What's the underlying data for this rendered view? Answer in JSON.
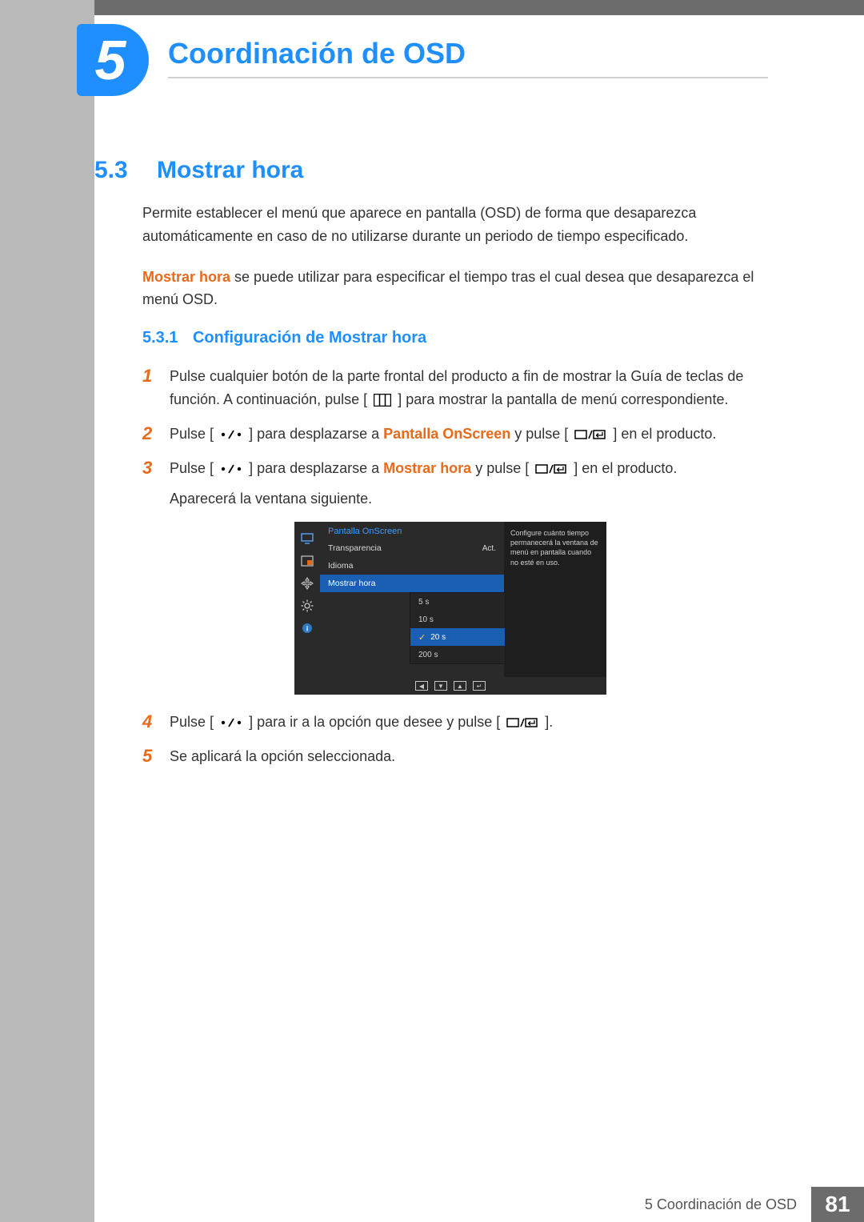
{
  "chapter": {
    "number": "5",
    "title": "Coordinación de OSD"
  },
  "section": {
    "number": "5.3",
    "title": "Mostrar hora"
  },
  "intro": {
    "p1": "Permite establecer el menú que aparece en pantalla (OSD) de forma que desaparezca automáticamente en caso de no utilizarse durante un periodo de tiempo especificado.",
    "p2_strong": "Mostrar hora",
    "p2_rest": " se puede utilizar para especificar el tiempo tras el cual desea que desaparezca el menú OSD."
  },
  "subsection": {
    "number": "5.3.1",
    "title": "Configuración de Mostrar hora"
  },
  "steps": {
    "s1": {
      "num": "1",
      "pre": "Pulse cualquier botón de la parte frontal del producto a fin de mostrar la Guía de teclas de función. A continuación, pulse [",
      "post": "] para mostrar la pantalla de menú correspondiente."
    },
    "s2": {
      "num": "2",
      "pre": "Pulse [",
      "mid1": "] para desplazarse a ",
      "strong": "Pantalla OnScreen",
      "mid2": " y pulse [",
      "post": "] en el producto."
    },
    "s3": {
      "num": "3",
      "pre": "Pulse [",
      "mid1": "] para desplazarse a ",
      "strong": "Mostrar hora",
      "mid2": " y pulse [",
      "post": "] en el producto.",
      "line2": "Aparecerá la ventana siguiente."
    },
    "s4": {
      "num": "4",
      "pre": "Pulse [",
      "mid": "] para ir a la opción que desee y pulse [",
      "post": "]."
    },
    "s5": {
      "num": "5",
      "text": "Se aplicará la opción seleccionada."
    }
  },
  "menu": {
    "title": "Pantalla OnScreen",
    "rows": {
      "transparency": {
        "label": "Transparencia",
        "value": "Act."
      },
      "language": {
        "label": "Idioma",
        "value": ""
      },
      "display_time": {
        "label": "Mostrar hora",
        "value": ""
      }
    },
    "options": {
      "o1": "5 s",
      "o2": "10 s",
      "o3": "20 s",
      "o4": "200 s"
    },
    "help": "Configure cuánto tiempo permanecerá la ventana de menú en pantalla cuando no esté en uso."
  },
  "footer": {
    "chapter_label": "5 Coordinación de OSD",
    "page": "81"
  }
}
